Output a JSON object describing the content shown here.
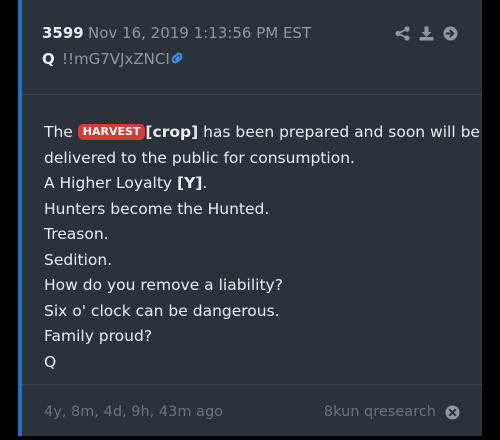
{
  "post": {
    "number": "3599",
    "date": "Nov 16, 2019 1:13:56 PM EST",
    "author": "Q",
    "tripcode": "!!mG7VJxZNCI",
    "icons": [
      "link-icon",
      "share-icon",
      "download-icon",
      "goto-icon",
      "dismiss-icon"
    ]
  },
  "body": {
    "line1_pre": "The",
    "harvest_badge": "HARVEST",
    "crop": "[crop]",
    "line1_post": "has been prepared and soon will be",
    "line2": "delivered to the public for consumption.",
    "line3_pre": "A Higher Loyalty",
    "line3_bold": "[Y]",
    "line3_post": ".",
    "line4": "Hunters become the Hunted.",
    "line5": "Treason.",
    "line6": "Sedition.",
    "line7": "How do you remove a liability?",
    "line8": "Six o' clock can be dangerous.",
    "line9": "Family proud?",
    "line10": "Q"
  },
  "footer": {
    "relative_time": "4y, 8m, 4d, 9h, 43m ago",
    "source": "8kun qresearch"
  },
  "colors": {
    "card_bg": "#2c323a",
    "accent": "#1e6fc6",
    "badge": "#d13d3d",
    "link": "#3a8fe8"
  }
}
